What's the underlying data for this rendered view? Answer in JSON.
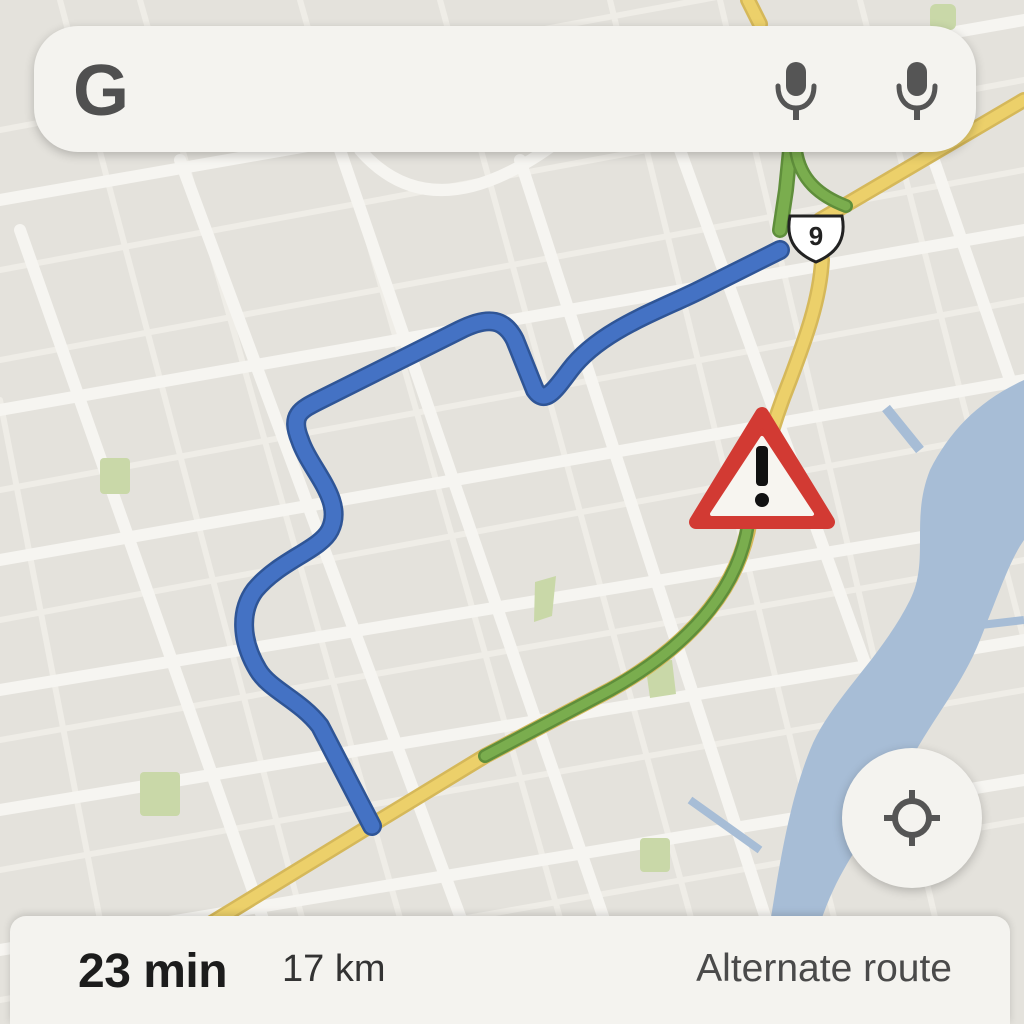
{
  "search": {
    "logo_letter": "G",
    "mic_icon_1": "mic-icon",
    "mic_icon_2": "mic-icon"
  },
  "map": {
    "highway_shield": "9",
    "warning_icon": "warning-triangle-icon",
    "colors": {
      "land": "#e4e2dc",
      "street": "#f6f5f1",
      "minor_street": "#efede7",
      "park": "#c9d8a8",
      "water": "#a7bdd6",
      "highway": "#ecd06a",
      "route_blue": "#4472c4",
      "route_green": "#7aad4e",
      "warning_red": "#d23a33"
    }
  },
  "controls": {
    "locate_icon": "my-location-icon"
  },
  "route_panel": {
    "eta": "23 min",
    "distance": "17 km",
    "alternate_label": "Alternate route"
  }
}
